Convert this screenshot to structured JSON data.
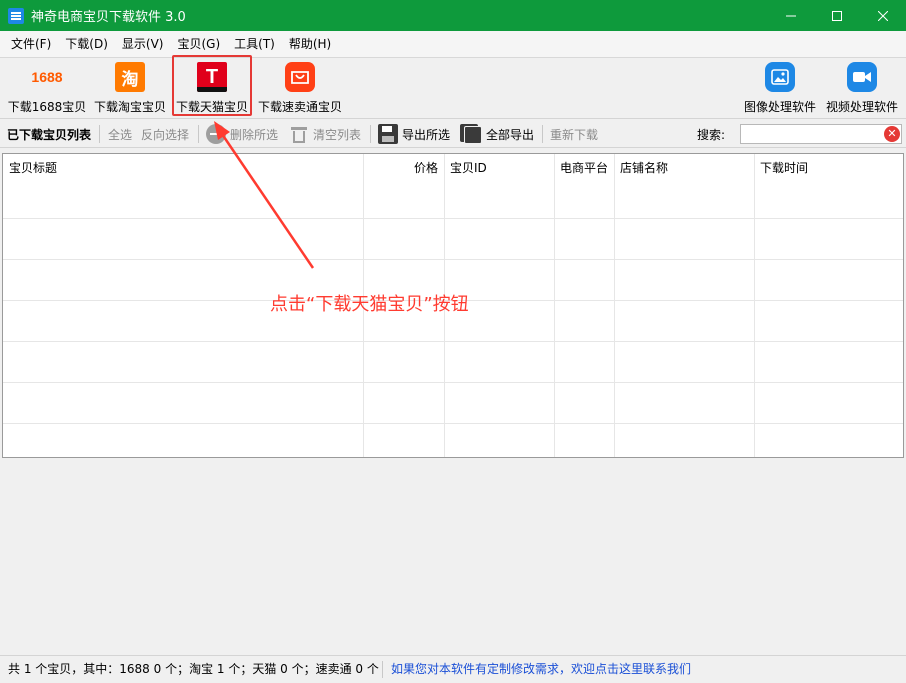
{
  "window": {
    "title": "神奇电商宝贝下载软件 3.0",
    "controls": {
      "minimize": "—",
      "maximize": "☐",
      "close": "✕"
    }
  },
  "menu": [
    "文件(F)",
    "下载(D)",
    "显示(V)",
    "宝贝(G)",
    "工具(T)",
    "帮助(H)"
  ],
  "toolbar": {
    "dl_1688": {
      "label": "下载1688宝贝",
      "icon_text": "1688",
      "icon": "1688-logo-icon"
    },
    "dl_taobao": {
      "label": "下载淘宝宝贝",
      "icon_text": "淘",
      "icon": "taobao-logo-icon"
    },
    "dl_tmall": {
      "label": "下载天猫宝贝",
      "icon_text": "T",
      "icon": "tmall-logo-icon"
    },
    "dl_aliexpress": {
      "label": "下载速卖通宝贝",
      "icon": "aliexpress-logo-icon"
    },
    "image_tool": {
      "label": "图像处理软件",
      "icon": "image-icon"
    },
    "video_tool": {
      "label": "视频处理软件",
      "icon": "video-camera-icon"
    }
  },
  "subtoolbar": {
    "list_title": "已下载宝贝列表",
    "select_all": "全选",
    "invert_select": "反向选择",
    "delete_selected": "删除所选",
    "clear_list": "清空列表",
    "export_selected": "导出所选",
    "export_all": "全部导出",
    "redownload": "重新下载",
    "search_label": "搜索:",
    "search_value": ""
  },
  "table": {
    "columns": [
      "宝贝标题",
      "价格",
      "宝贝ID",
      "电商平台",
      "店铺名称",
      "下载时间"
    ],
    "rows": []
  },
  "annotation": "点击“下载天猫宝贝”按钮",
  "status": {
    "summary": "共 1 个宝贝，其中：1688 0 个；淘宝 1 个；天猫 0 个；速卖通 0 个",
    "link": "如果您对本软件有定制修改需求，欢迎点击这里联系我们"
  },
  "colors": {
    "titlebar": "#0e9a3c",
    "highlight": "#e53935",
    "annotation": "#ff3b30",
    "link": "#1a4fd6"
  }
}
